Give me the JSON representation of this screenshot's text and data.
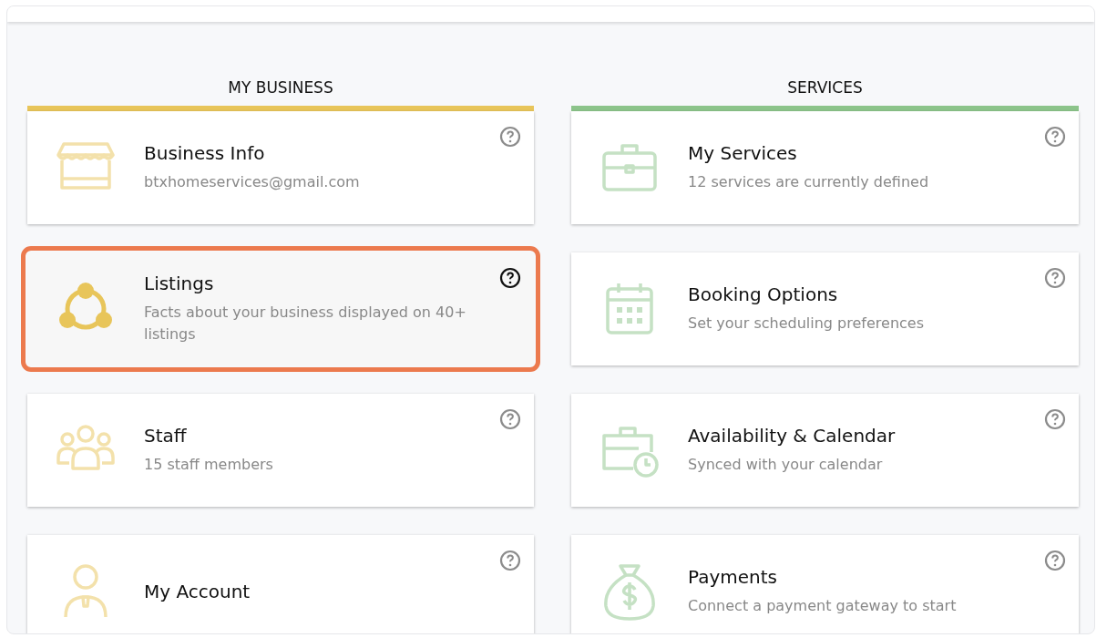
{
  "columns": [
    {
      "heading": "MY BUSINESS",
      "color": "#e8c55a",
      "cards": [
        {
          "kind": "store",
          "title": "Business Info",
          "subtitle": "btxhomeservices@gmail.com",
          "highlighted": false
        },
        {
          "kind": "network",
          "title": "Listings",
          "subtitle": "Facts about your business displayed on 40+ listings",
          "highlighted": true
        },
        {
          "kind": "people",
          "title": "Staff",
          "subtitle": "15 staff members",
          "highlighted": false
        },
        {
          "kind": "person",
          "title": "My Account",
          "highlighted": false
        }
      ]
    },
    {
      "heading": "SERVICES",
      "color": "#8cc48a",
      "cards": [
        {
          "kind": "briefcase",
          "title": "My Services",
          "subtitle": "12 services are currently defined",
          "highlighted": false
        },
        {
          "kind": "calendar",
          "title": "Booking Options",
          "subtitle": "Set your scheduling preferences",
          "highlighted": false
        },
        {
          "kind": "briefcase-clock",
          "title": "Availability & Calendar",
          "subtitle": "Synced with your calendar",
          "highlighted": false
        },
        {
          "kind": "moneybag",
          "title": "Payments",
          "subtitle": "Connect a payment gateway to start",
          "highlighted": false
        }
      ]
    }
  ]
}
